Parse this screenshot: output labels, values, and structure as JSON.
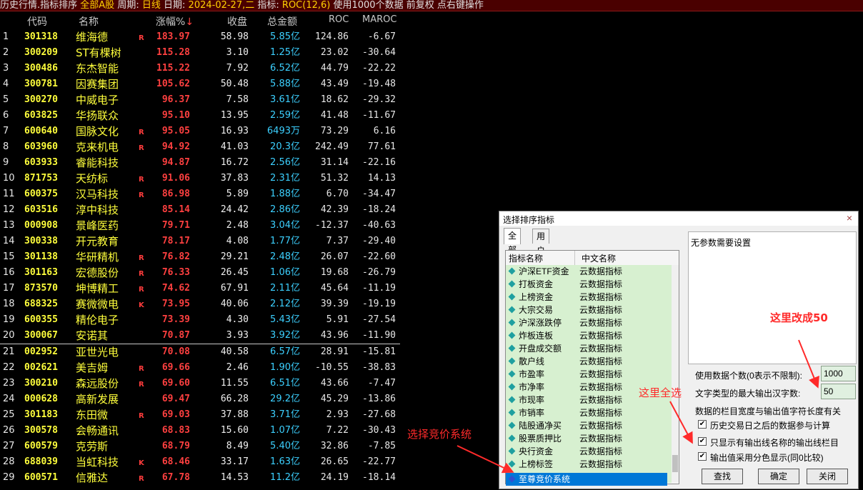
{
  "topbar": {
    "title": "历史行情.指标排序",
    "market": "全部A股",
    "period_label": "周期:",
    "period": "日线",
    "date_label": "日期:",
    "date": "2024-02-27,二",
    "indicator_label": "指标:",
    "indicator": "ROC(12,6)",
    "note": "使用1000个数据 前复权 点右键操作"
  },
  "table": {
    "headers": {
      "code": "代码",
      "name": "名称",
      "pct": "涨幅%",
      "sort_icon": "↓",
      "close": "收盘",
      "amount": "总金额",
      "roc": "ROC",
      "maroc": "MAROC"
    },
    "rows": [
      {
        "idx": "1",
        "code": "301318",
        "name": "维海德",
        "flag": "R",
        "pct": "183.97",
        "close": "58.98",
        "amount": "5.85亿",
        "roc": "124.86",
        "maroc": "-6.67"
      },
      {
        "idx": "2",
        "code": "300209",
        "name": "ST有棵树",
        "flag": "",
        "pct": "115.28",
        "close": "3.10",
        "amount": "1.25亿",
        "roc": "23.02",
        "maroc": "-30.64"
      },
      {
        "idx": "3",
        "code": "300486",
        "name": "东杰智能",
        "flag": "",
        "pct": "115.22",
        "close": "7.92",
        "amount": "6.52亿",
        "roc": "44.79",
        "maroc": "-22.22"
      },
      {
        "idx": "4",
        "code": "300781",
        "name": "因赛集团",
        "flag": "",
        "pct": "105.62",
        "close": "50.48",
        "amount": "5.88亿",
        "roc": "43.49",
        "maroc": "-19.48"
      },
      {
        "idx": "5",
        "code": "300270",
        "name": "中威电子",
        "flag": "",
        "pct": "96.37",
        "close": "7.58",
        "amount": "3.61亿",
        "roc": "18.62",
        "maroc": "-29.32"
      },
      {
        "idx": "6",
        "code": "603825",
        "name": "华扬联众",
        "flag": "",
        "pct": "95.10",
        "close": "13.95",
        "amount": "2.59亿",
        "roc": "41.48",
        "maroc": "-11.67"
      },
      {
        "idx": "7",
        "code": "600640",
        "name": "国脉文化",
        "flag": "R",
        "pct": "95.05",
        "close": "16.93",
        "amount": "6493万",
        "roc": "73.29",
        "maroc": "6.16"
      },
      {
        "idx": "8",
        "code": "603960",
        "name": "克来机电",
        "flag": "R",
        "pct": "94.92",
        "close": "41.03",
        "amount": "20.3亿",
        "roc": "242.49",
        "maroc": "77.61"
      },
      {
        "idx": "9",
        "code": "603933",
        "name": "睿能科技",
        "flag": "",
        "pct": "94.87",
        "close": "16.72",
        "amount": "2.56亿",
        "roc": "31.14",
        "maroc": "-22.16"
      },
      {
        "idx": "10",
        "code": "871753",
        "name": "天纺标",
        "flag": "R",
        "pct": "91.06",
        "close": "37.83",
        "amount": "2.31亿",
        "roc": "51.32",
        "maroc": "14.13"
      },
      {
        "idx": "11",
        "code": "600375",
        "name": "汉马科技",
        "flag": "R",
        "pct": "86.98",
        "close": "5.89",
        "amount": "1.88亿",
        "roc": "6.70",
        "maroc": "-34.47"
      },
      {
        "idx": "12",
        "code": "603516",
        "name": "淳中科技",
        "flag": "",
        "pct": "85.14",
        "close": "24.42",
        "amount": "2.86亿",
        "roc": "42.39",
        "maroc": "-18.24"
      },
      {
        "idx": "13",
        "code": "000908",
        "name": "景峰医药",
        "flag": "",
        "pct": "79.71",
        "close": "2.48",
        "amount": "3.04亿",
        "roc": "-12.37",
        "maroc": "-40.63"
      },
      {
        "idx": "14",
        "code": "300338",
        "name": "开元教育",
        "flag": "",
        "pct": "78.17",
        "close": "4.08",
        "amount": "1.77亿",
        "roc": "7.37",
        "maroc": "-29.40"
      },
      {
        "idx": "15",
        "code": "301138",
        "name": "华研精机",
        "flag": "R",
        "pct": "76.82",
        "close": "29.21",
        "amount": "2.48亿",
        "roc": "26.07",
        "maroc": "-22.60"
      },
      {
        "idx": "16",
        "code": "301163",
        "name": "宏德股份",
        "flag": "R",
        "pct": "76.33",
        "close": "26.45",
        "amount": "1.06亿",
        "roc": "19.68",
        "maroc": "-26.79"
      },
      {
        "idx": "17",
        "code": "873570",
        "name": "坤博精工",
        "flag": "R",
        "pct": "74.62",
        "close": "67.91",
        "amount": "2.11亿",
        "roc": "45.64",
        "maroc": "-11.19"
      },
      {
        "idx": "18",
        "code": "688325",
        "name": "赛微微电",
        "flag": "K",
        "pct": "73.95",
        "close": "40.06",
        "amount": "2.12亿",
        "roc": "39.39",
        "maroc": "-19.19"
      },
      {
        "idx": "19",
        "code": "600355",
        "name": "精伦电子",
        "flag": "",
        "pct": "73.39",
        "close": "4.30",
        "amount": "5.43亿",
        "roc": "5.91",
        "maroc": "-27.54"
      },
      {
        "idx": "20",
        "code": "300067",
        "name": "安诺其",
        "flag": "",
        "pct": "70.87",
        "close": "3.93",
        "amount": "3.92亿",
        "roc": "43.96",
        "maroc": "-11.90"
      },
      {
        "idx": "21",
        "code": "002952",
        "name": "亚世光电",
        "flag": "",
        "pct": "70.08",
        "close": "40.58",
        "amount": "6.57亿",
        "roc": "28.91",
        "maroc": "-15.81"
      },
      {
        "idx": "22",
        "code": "002621",
        "name": "美吉姆",
        "flag": "R",
        "pct": "69.66",
        "close": "2.46",
        "amount": "1.90亿",
        "roc": "-10.55",
        "maroc": "-38.83"
      },
      {
        "idx": "23",
        "code": "300210",
        "name": "森远股份",
        "flag": "R",
        "pct": "69.60",
        "close": "11.55",
        "amount": "6.51亿",
        "roc": "43.66",
        "maroc": "-7.47"
      },
      {
        "idx": "24",
        "code": "000628",
        "name": "高新发展",
        "flag": "",
        "pct": "69.47",
        "close": "66.28",
        "amount": "29.2亿",
        "roc": "45.29",
        "maroc": "-13.86"
      },
      {
        "idx": "25",
        "code": "301183",
        "name": "东田微",
        "flag": "R",
        "pct": "69.03",
        "close": "37.88",
        "amount": "3.71亿",
        "roc": "2.93",
        "maroc": "-27.68"
      },
      {
        "idx": "26",
        "code": "300578",
        "name": "会畅通讯",
        "flag": "",
        "pct": "68.83",
        "close": "15.60",
        "amount": "1.07亿",
        "roc": "7.22",
        "maroc": "-30.43"
      },
      {
        "idx": "27",
        "code": "600579",
        "name": "克劳斯",
        "flag": "",
        "pct": "68.79",
        "close": "8.49",
        "amount": "5.40亿",
        "roc": "32.86",
        "maroc": "-7.85"
      },
      {
        "idx": "28",
        "code": "688039",
        "name": "当虹科技",
        "flag": "K",
        "pct": "68.46",
        "close": "33.17",
        "amount": "1.63亿",
        "roc": "26.65",
        "maroc": "-22.77"
      },
      {
        "idx": "29",
        "code": "600571",
        "name": "信雅达",
        "flag": "R",
        "pct": "67.78",
        "close": "14.53",
        "amount": "11.2亿",
        "roc": "24.19",
        "maroc": "-18.14"
      }
    ]
  },
  "dialog": {
    "title": "选择排序指标",
    "tabs": [
      "全部",
      "用户"
    ],
    "list_headers": {
      "name": "指标名称",
      "cn_name": "中文名称"
    },
    "items": [
      {
        "name": "沪深ETF资金",
        "cn": "云数据指标"
      },
      {
        "name": "打板资金",
        "cn": "云数据指标"
      },
      {
        "name": "上榜资金",
        "cn": "云数据指标"
      },
      {
        "name": "大宗交易",
        "cn": "云数据指标"
      },
      {
        "name": "沪深涨跌停",
        "cn": "云数据指标"
      },
      {
        "name": "炸板连板",
        "cn": "云数据指标"
      },
      {
        "name": "开盘成交额",
        "cn": "云数据指标"
      },
      {
        "name": "散户线",
        "cn": "云数据指标"
      },
      {
        "name": "市盈率",
        "cn": "云数据指标"
      },
      {
        "name": "市净率",
        "cn": "云数据指标"
      },
      {
        "name": "市现率",
        "cn": "云数据指标"
      },
      {
        "name": "市销率",
        "cn": "云数据指标"
      },
      {
        "name": "陆股通净买",
        "cn": "云数据指标"
      },
      {
        "name": "股票质押比",
        "cn": "云数据指标"
      },
      {
        "name": "央行资金",
        "cn": "云数据指标"
      },
      {
        "name": "上榜标签",
        "cn": "云数据指标"
      }
    ],
    "selected_item": "至尊竞价系统",
    "param_text": "无参数需要设置",
    "data_count_label": "使用数据个数(0表示不限制):",
    "data_count_value": "1000",
    "max_chars_label": "文字类型的最大输出汉字数:",
    "max_chars_value": "50",
    "width_note": "数据的栏目宽度与输出值字符长度有关",
    "checkboxes": [
      {
        "label": "历史交易日之后的数据参与计算",
        "checked": "✔"
      },
      {
        "label": "只显示有输出线名称的输出线栏目",
        "checked": "✔"
      },
      {
        "label": "输出值采用分色显示(同0比较)",
        "checked": "✔"
      }
    ],
    "buttons": {
      "find": "查找",
      "ok": "确定",
      "close": "关闭"
    },
    "close_glyph": "×"
  },
  "annotations": {
    "change_to_50": "这里改成50",
    "select_all": "这里全选",
    "choose_system": "选择竞价系统"
  },
  "colors": {
    "code": "#ffff3c",
    "pct": "#ff4040",
    "amount": "#3cd0ff",
    "annotation": "#ff2a2a",
    "list_bg": "#d7f0d0",
    "selected": "#0078d7"
  }
}
